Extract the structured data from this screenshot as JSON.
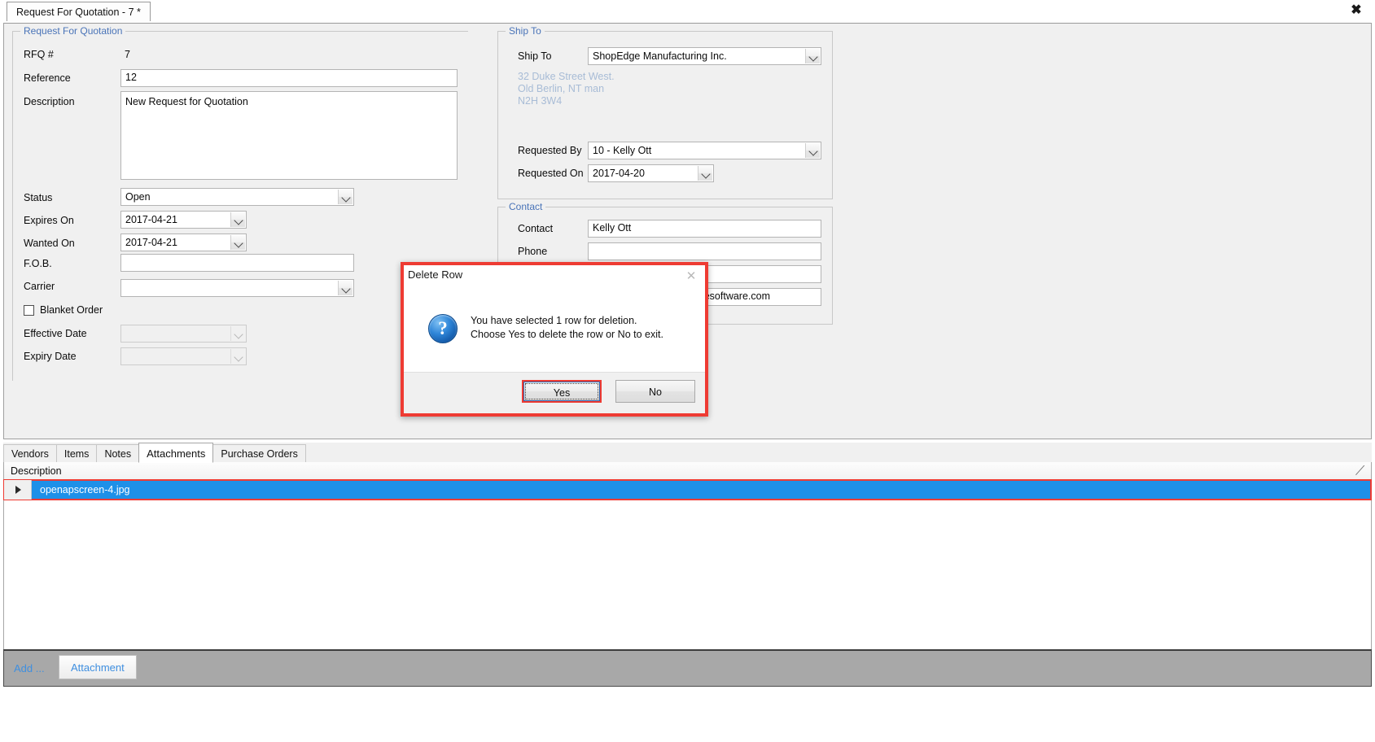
{
  "window": {
    "tab_title": "Request For Quotation - 7 *",
    "close_icon": "close-icon",
    "close_glyph": "✖"
  },
  "rfq_group": {
    "title": "Request For Quotation",
    "fields": {
      "rfq_number_label": "RFQ #",
      "rfq_number_value": "7",
      "reference_label": "Reference",
      "reference_value": "12",
      "description_label": "Description",
      "description_value": "New Request for Quotation",
      "status_label": "Status",
      "status_value": "Open",
      "expires_on_label": "Expires On",
      "expires_on_value": "2017-04-21",
      "wanted_on_label": "Wanted On",
      "wanted_on_value": "2017-04-21",
      "fob_label": "F.O.B.",
      "fob_value": "",
      "carrier_label": "Carrier",
      "carrier_value": "",
      "blanket_order_label": "Blanket Order",
      "blanket_order_checked": false,
      "effective_date_label": "Effective Date",
      "effective_date_value": "",
      "expiry_date_label": "Expiry Date",
      "expiry_date_value": ""
    }
  },
  "ship_to_group": {
    "title": "Ship To",
    "ship_to_label": "Ship To",
    "ship_to_value": "ShopEdge Manufacturing Inc.",
    "address_line_1": "32 Duke Street West.",
    "address_line_2": "Old Berlin, NT man",
    "address_line_3": "N2H 3W4",
    "requested_by_label": "Requested By",
    "requested_by_value": "10 - Kelly Ott",
    "requested_on_label": "Requested On",
    "requested_on_value": "2017-04-20"
  },
  "contact_group": {
    "title": "Contact",
    "contact_label": "Contact",
    "contact_value": "Kelly Ott",
    "phone_label": "Phone",
    "phone_value": "",
    "field3_value": "",
    "field4_value": "esoftware.com"
  },
  "bottom_tabs": {
    "items": [
      {
        "label": "Vendors",
        "active": false
      },
      {
        "label": "Items",
        "active": false
      },
      {
        "label": "Notes",
        "active": false
      },
      {
        "label": "Attachments",
        "active": true
      },
      {
        "label": "Purchase Orders",
        "active": false
      }
    ]
  },
  "grid": {
    "columns": [
      "Description"
    ],
    "sort_glyph": "╱",
    "rows": [
      {
        "description": "openapscreen-4.jpg",
        "selected": true
      }
    ]
  },
  "footer": {
    "add_label": "Add ...",
    "attachment_label": "Attachment"
  },
  "dialog": {
    "title": "Delete Row",
    "close_glyph": "✕",
    "icon": "question-icon",
    "message_line_1": "You have selected 1 row for deletion.",
    "message_line_2": "Choose Yes to delete the row or No to exit.",
    "yes_label": "Yes",
    "no_label": "No"
  },
  "colors": {
    "accent_blue": "#4a74b8",
    "selection_blue": "#1e90e8",
    "highlight_red": "#ee3b33",
    "link_blue": "#3f8fe0",
    "form_bg": "#f0f0f0",
    "footer_bg": "#a8a8a8"
  }
}
